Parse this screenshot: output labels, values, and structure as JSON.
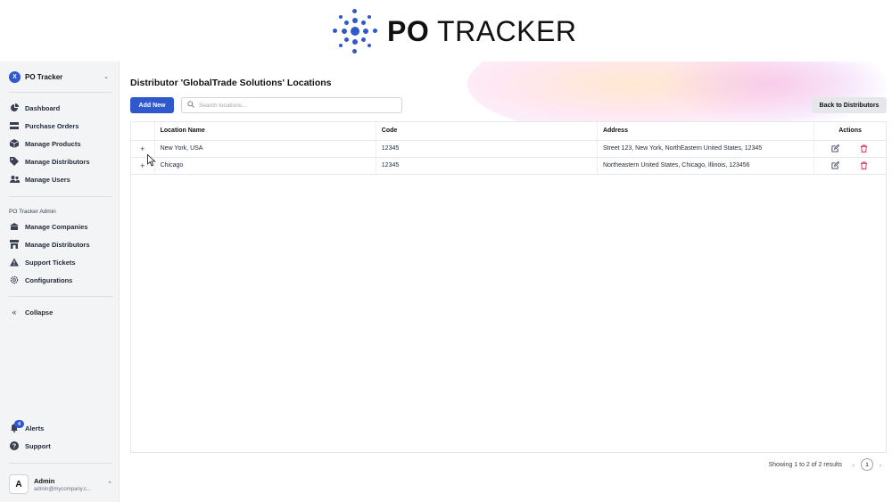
{
  "brand": {
    "bold": "PO",
    "light": "TRACKER",
    "color": "#2f58cd"
  },
  "sidebar": {
    "org_initial": "X",
    "org_name": "PO Tracker",
    "items": [
      {
        "label": "Dashboard",
        "icon": "dashboard-icon"
      },
      {
        "label": "Purchase Orders",
        "icon": "purchase-orders-icon"
      },
      {
        "label": "Manage Products",
        "icon": "box-icon"
      },
      {
        "label": "Manage Distributors",
        "icon": "tag-icon"
      },
      {
        "label": "Manage Users",
        "icon": "users-icon"
      }
    ],
    "admin_section_title": "PO Tracker Admin",
    "admin_items": [
      {
        "label": "Manage Companies",
        "icon": "building-icon"
      },
      {
        "label": "Manage Distributors",
        "icon": "store-icon"
      },
      {
        "label": "Support Tickets",
        "icon": "warning-icon"
      },
      {
        "label": "Configurations",
        "icon": "gear-icon"
      }
    ],
    "collapse_label": "Collapse",
    "alerts_label": "Alerts",
    "alerts_count": "4",
    "support_label": "Support",
    "user": {
      "initial": "A",
      "name": "Admin",
      "email": "admin@mycompany.c..."
    }
  },
  "main": {
    "title": "Distributor 'GlobalTrade Solutions' Locations",
    "add_new_label": "Add New",
    "search_placeholder": "Search locations...",
    "back_label": "Back to Distributors",
    "table": {
      "columns": [
        "Location Name",
        "Code",
        "Address",
        "Actions"
      ],
      "rows": [
        {
          "expander": "+",
          "name": "New York, USA",
          "code": "12345",
          "address": "Street 123, New York, NorthEastern United States, 12345"
        },
        {
          "expander": "+",
          "name": "Chicago",
          "code": "12345",
          "address": "Northeastern United States, Chicago, Illinois, 123456"
        }
      ]
    },
    "footer": {
      "showing": "Showing 1 to 2 of 2 results",
      "page": "1"
    }
  }
}
